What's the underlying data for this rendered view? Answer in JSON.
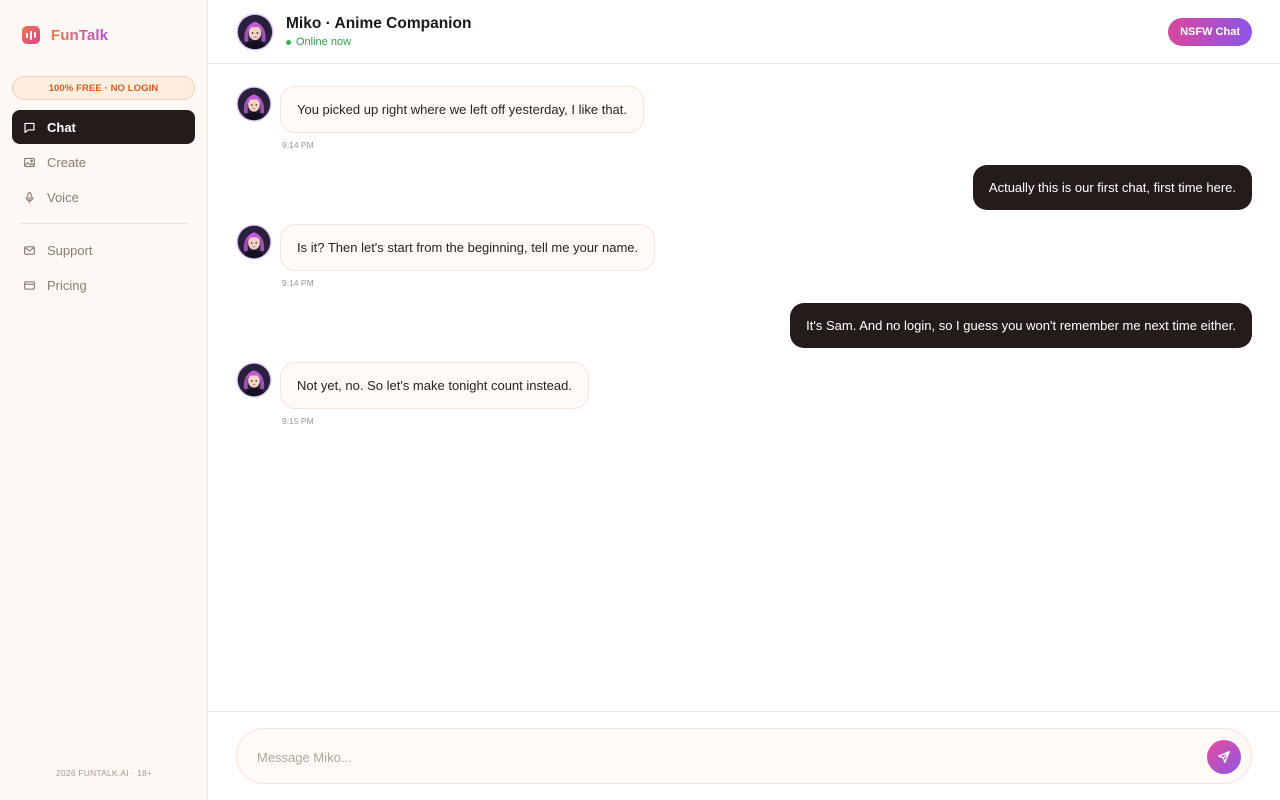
{
  "brand": {
    "name": "FunTalk"
  },
  "sidebar": {
    "badge": "100% FREE · NO LOGIN",
    "nav_primary": [
      {
        "label": "Chat",
        "icon": "chat-bubble-icon",
        "active": true
      },
      {
        "label": "Create",
        "icon": "image-icon",
        "active": false
      },
      {
        "label": "Voice",
        "icon": "microphone-icon",
        "active": false
      }
    ],
    "nav_secondary": [
      {
        "label": "Support",
        "icon": "mail-icon"
      },
      {
        "label": "Pricing",
        "icon": "credit-card-icon"
      }
    ],
    "footer": "2026 FUNTALK.AI · 18+"
  },
  "header": {
    "title": "Miko · Anime Companion",
    "status": "Online now",
    "nsfw_button": "NSFW Chat"
  },
  "messages": [
    {
      "from": "bot",
      "text": "You picked up right where we left off yesterday, I like that.",
      "time": "9:14 PM"
    },
    {
      "from": "user",
      "text": "Actually this is our first chat, first time here."
    },
    {
      "from": "bot",
      "text": "Is it? Then let's start from the beginning, tell me your name.",
      "time": "9:14 PM"
    },
    {
      "from": "user",
      "text": "It's Sam. And no login, so I guess you won't remember me next time either."
    },
    {
      "from": "bot",
      "text": "Not yet, no. So let's make tonight count instead.",
      "time": "9:15 PM"
    }
  ],
  "composer": {
    "placeholder": "Message Miko..."
  },
  "colors": {
    "accent_start": "#d9479e",
    "accent_end": "#8e55e8",
    "dark": "#231c1a",
    "online": "#39b054",
    "badge_text": "#d55d1d"
  }
}
